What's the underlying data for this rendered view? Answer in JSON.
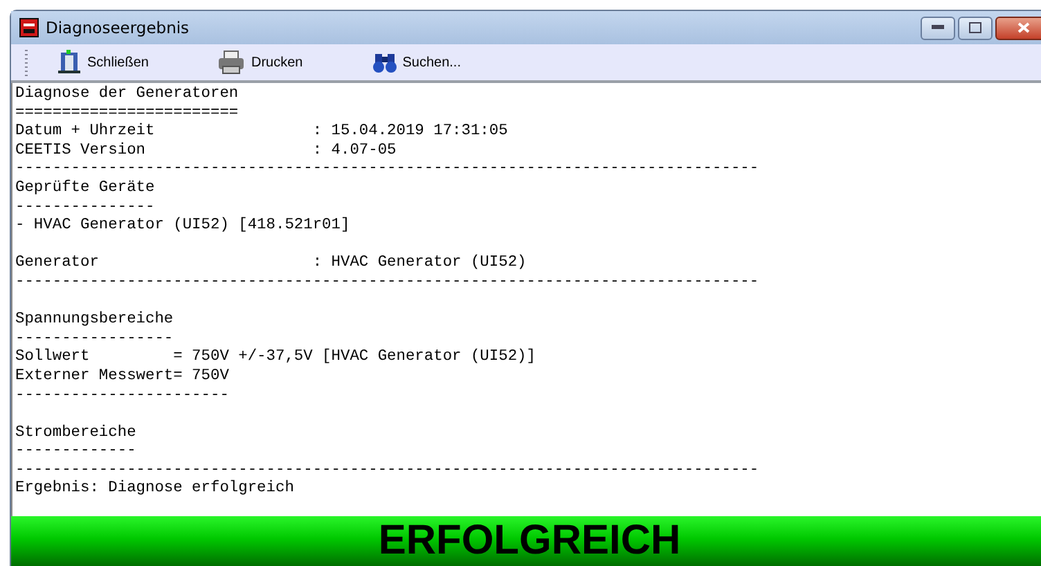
{
  "window": {
    "title": "Diagnoseergebnis"
  },
  "toolbar": [
    {
      "label": "Schließen",
      "kind": "close"
    },
    {
      "label": "Drucken",
      "kind": "print"
    },
    {
      "label": "Suchen...",
      "kind": "search"
    }
  ],
  "report_lines": [
    {
      "kind": "text",
      "text": "Diagnose der Generatoren"
    },
    {
      "kind": "text",
      "text": "========================"
    },
    {
      "kind": "text",
      "text": "Datum + Uhrzeit                 : 15.04.2019 17:31:05"
    },
    {
      "kind": "text",
      "text": "CEETIS Version                  : 4.07-05"
    },
    {
      "kind": "text",
      "text": "--------------------------------------------------------------------------------"
    },
    {
      "kind": "text",
      "text": "Geprüfte Geräte"
    },
    {
      "kind": "text",
      "text": "---------------"
    },
    {
      "kind": "text",
      "text": "- HVAC Generator (UI52) [418.521r01]"
    },
    {
      "kind": "blank"
    },
    {
      "kind": "text",
      "text": "Generator                       : HVAC Generator (UI52)"
    },
    {
      "kind": "text",
      "text": "--------------------------------------------------------------------------------"
    },
    {
      "kind": "blank"
    },
    {
      "kind": "text",
      "text": "Spannungsbereiche"
    },
    {
      "kind": "text",
      "text": "-----------------"
    },
    {
      "kind": "text",
      "text": "Sollwert         = 750V +/-37,5V [HVAC Generator (UI52)]"
    },
    {
      "kind": "text",
      "text": "Externer Messwert= 750V"
    },
    {
      "kind": "text",
      "text": "-----------------------"
    },
    {
      "kind": "blank"
    },
    {
      "kind": "text",
      "text": "Strombereiche"
    },
    {
      "kind": "text",
      "text": "-------------"
    },
    {
      "kind": "text",
      "text": "--------------------------------------------------------------------------------"
    },
    {
      "kind": "text",
      "text": "Ergebnis: Diagnose erfolgreich"
    }
  ],
  "result_banner": {
    "text": "ERFOLGREICH",
    "passed": true
  }
}
